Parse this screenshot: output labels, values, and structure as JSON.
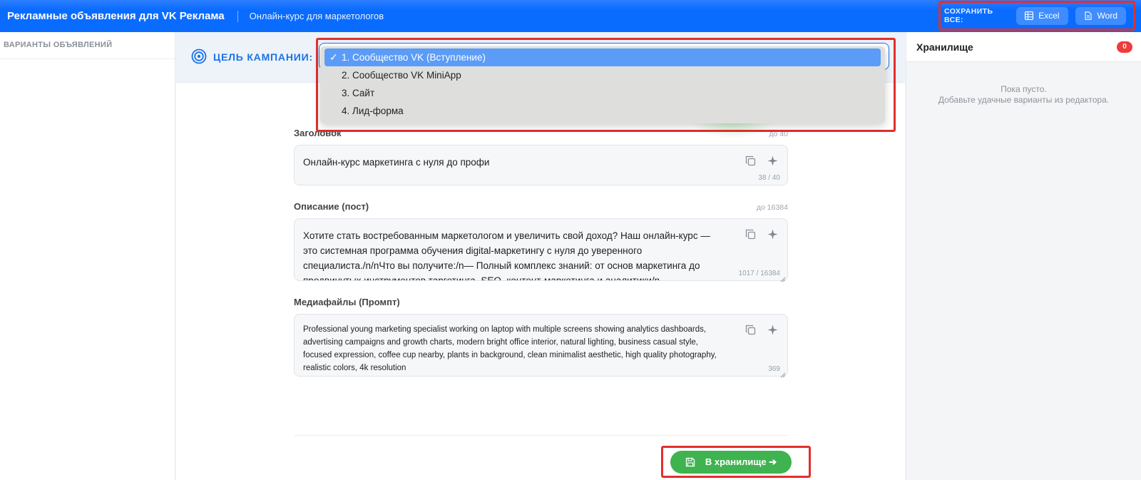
{
  "header": {
    "app_title": "Рекламные объявления для VK Реклама",
    "subtitle": "Онлайн-курс для маркетологов",
    "save_all_label": "СОХРАНИТЬ ВСЕ:",
    "excel_label": "Excel",
    "word_label": "Word"
  },
  "sidebar": {
    "title": "ВАРИАНТЫ ОБЪЯВЛЕНИЙ"
  },
  "campaign": {
    "goal_label": "ЦЕЛЬ КАМПАНИИ:",
    "options": [
      "1. Сообщество VK (Вступление)",
      "2. Сообщество VK MiniApp",
      "3. Сайт",
      "4. Лид-форма"
    ],
    "selected_index": 0
  },
  "fields": {
    "title": {
      "label": "Заголовок",
      "limit": "до 40",
      "value": "Онлайн-курс маркетинга с нуля до профи",
      "counter": "38 / 40"
    },
    "description": {
      "label": "Описание (пост)",
      "limit": "до 16384",
      "value": "Хотите стать востребованным маркетологом и увеличить свой доход? Наш онлайн-курс — это системная программа обучения digital-маркетингу с нуля до уверенного специалиста./n/nЧто вы получите:/n— Полный комплекс знаний: от основ маркетинга до продвинутых инструментов таргетинга, SEO, контент-маркетинга и аналитики/n—",
      "counter": "1017 / 16384"
    },
    "media": {
      "label": "Медиафайлы (Промпт)",
      "value": "Professional young marketing specialist working on laptop with multiple screens showing analytics dashboards, advertising campaigns and growth charts, modern bright office interior, natural lighting, business casual style, focused expression, coffee cup nearby, plants in background, clean minimalist aesthetic, high quality photography, realistic colors, 4k resolution",
      "counter": "369"
    }
  },
  "actions": {
    "store_button": "В хранилище ➔"
  },
  "storage": {
    "title": "Хранилище",
    "count": "0",
    "empty_line1": "Пока пусто.",
    "empty_line2": "Добавьте удачные варианты из редактора."
  },
  "colors": {
    "topbar": "#0a6cff",
    "accent": "#1a73e8",
    "highlight_frame": "#e0302d",
    "store_button": "#3fb34f",
    "badge": "#ef3b3b"
  },
  "icons": [
    "table-icon",
    "document-icon",
    "target-icon",
    "copy-icon",
    "sparkle-icon",
    "save-icon",
    "checkmark-icon"
  ]
}
